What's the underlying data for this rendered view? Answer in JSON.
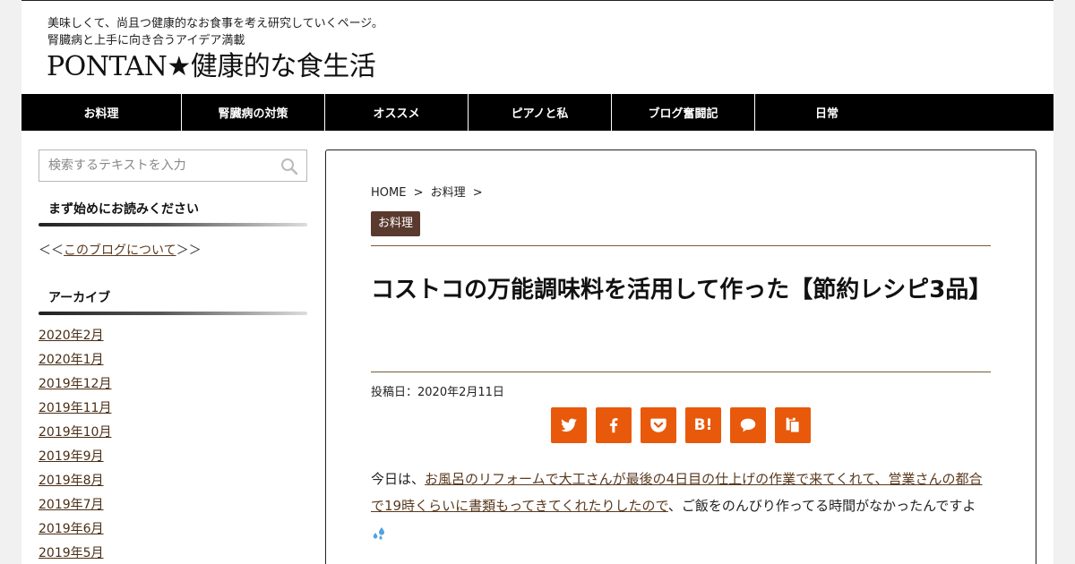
{
  "header": {
    "tagline_1": "美味しくて、尚且つ健康的なお食事を考え研究していくページ。",
    "tagline_2": "腎臓病と上手に向き合うアイデア満載",
    "site_title": "PONTAN★健康的な食生活"
  },
  "nav": {
    "items": [
      {
        "label": "お料理"
      },
      {
        "label": "腎臓病の対策"
      },
      {
        "label": "オススメ"
      },
      {
        "label": "ピアノと私"
      },
      {
        "label": "ブログ奮闘記"
      },
      {
        "label": "日常"
      }
    ]
  },
  "sidebar": {
    "search_placeholder": "検索するテキストを入力",
    "widget_start_title": "まず始めにお読みください",
    "about_prefix": "＜＜",
    "about_link": "このブログについて",
    "about_suffix": "＞＞",
    "archive_title": "アーカイブ",
    "archives": [
      "2020年2月",
      "2020年1月",
      "2019年12月",
      "2019年11月",
      "2019年10月",
      "2019年9月",
      "2019年8月",
      "2019年7月",
      "2019年6月",
      "2019年5月"
    ]
  },
  "main": {
    "breadcrumb_home": "HOME",
    "breadcrumb_sep": ">",
    "breadcrumb_cat": "お料理",
    "category_badge": "お料理",
    "title": "コストコの万能調味料を活用して作った【節約レシピ3品】",
    "post_date": "投稿日：2020年2月11日",
    "share": {
      "hatena_label": "B!"
    },
    "body_prefix": "今日は、",
    "body_link": "お風呂のリフォームで大工さんが最後の4日目の仕上げの作業で来てくれて、営業さんの都合で19時くらいに書類もってきてくれたりしたので",
    "body_suffix": "、ご飯をのんびり作ってる時間がなかったんですよ"
  },
  "colors": {
    "nav_bg": "#000000",
    "share_orange": "#e8590c",
    "badge_brown": "#5a3a2e",
    "link_brown": "#5a3a1e"
  },
  "icons": {
    "search": "search-icon",
    "twitter": "twitter-icon",
    "facebook": "facebook-icon",
    "pocket": "pocket-icon",
    "hatena": "hatena-bookmark-icon",
    "line": "line-chat-icon",
    "copy": "copy-icon",
    "sweat": "sweat-drops-icon"
  }
}
